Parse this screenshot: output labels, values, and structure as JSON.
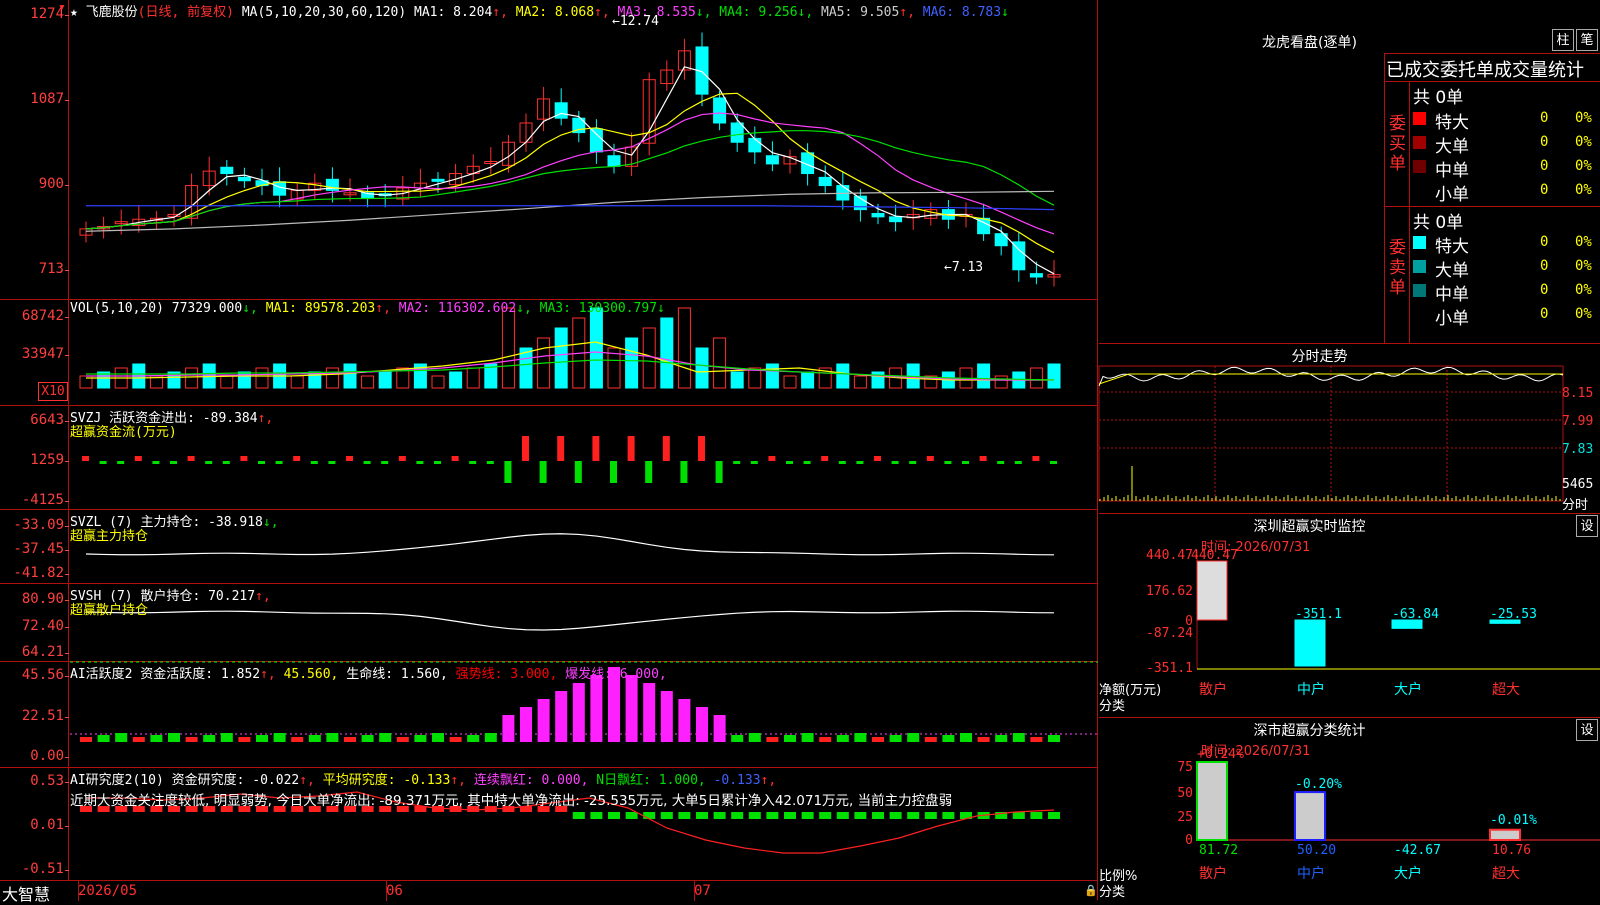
{
  "stock": {
    "star": "★",
    "name": "飞鹿股份",
    "mode": "(日线, 前复权)",
    "ma_label": "MA(5,10,20,30,60,120)",
    "ma": [
      {
        "name": "MA1",
        "value": "8.204",
        "arrow": "↑",
        "color": "#ffffff"
      },
      {
        "name": "MA2",
        "value": "8.068",
        "arrow": "↑",
        "color": "#ffff00"
      },
      {
        "name": "MA3",
        "value": "8.535",
        "arrow": "↓",
        "color": "#ff40ff"
      },
      {
        "name": "MA4",
        "value": "9.256",
        "arrow": "↓",
        "color": "#00e000"
      },
      {
        "name": "MA5",
        "value": "9.505",
        "arrow": "↑",
        "color": "#cccccc"
      },
      {
        "name": "MA6",
        "value": "8.783",
        "arrow": "↓",
        "color": "#4060ff"
      }
    ],
    "high_marker": "12.74",
    "low_marker": "7.13"
  },
  "price_axis": [
    "1274",
    "1087",
    "900",
    "713"
  ],
  "vol": {
    "label": "VOL(5,10,20)",
    "value": "77329.000",
    "value_arrow": "↓,",
    "ma1": "MA1: 89578.203",
    "ma1_arrow": "↑,",
    "ma2": "MA2: 116302.602",
    "ma2_arrow": "↓,",
    "ma3": "MA3: 130300.797",
    "ma3_arrow": "↓",
    "axis": [
      "68742",
      "33947",
      "X10"
    ]
  },
  "svzj": {
    "l1": "SVZJ  活跃资金进出: -89.384",
    "l1_arrow": "↑,",
    "l2": "超赢资金流(万元)",
    "axis": [
      "6643",
      "1259",
      "-4125"
    ]
  },
  "svzl": {
    "l1": "SVZL (7) 主力持仓: -38.918",
    "l1_arrow": "↓,",
    "l2": "超赢主力持仓",
    "axis": [
      "-33.09",
      "-37.45",
      "-41.82"
    ]
  },
  "svsh": {
    "l1": "SVSH (7) 散户持仓: 70.217",
    "l1_arrow": "↑,",
    "l2": "超赢散户持仓",
    "axis": [
      "80.90",
      "72.40",
      "64.21"
    ]
  },
  "ai1": {
    "l1": "AI活跃度2 资金活跃度: 1.852",
    "l1_arrow": "↑,",
    "a": "45.560,",
    "b": "生命线: 1.560,",
    "c": "强势线: 3.000,",
    "d": "爆发线: 6.000,",
    "axis": [
      "45.56",
      "22.51",
      "0.00"
    ]
  },
  "ai2": {
    "l1": "AI研究度2(10) 资金研究度: -0.022",
    "l1_arrow": "↑,",
    "a": "平均研究度: -0.133",
    "a_arrow": "↑,",
    "b": "连续飘红: 0.000,",
    "c": "N日飘红: 1.000,",
    "d": "-0.133",
    "d_arrow": "↑,",
    "note": "近期大资金关注度较低, 明显弱势, 今日大单净流出: -89.371万元, 其中特大单净流出: -25.535万元, 大单5日累计净入42.071万元, 当前主力控盘弱",
    "axis": [
      "0.53",
      "0.01",
      "-0.51"
    ]
  },
  "bottom": {
    "brand": "大智慧",
    "dates": [
      "2026/05",
      "06",
      "07"
    ]
  },
  "longhu": {
    "title": "龙虎看盘(逐单)",
    "btn1": "柱",
    "btn2": "笔",
    "header": "已成交委托单成交量统计",
    "buy_label": "委买单",
    "sell_label": "委卖单",
    "buy_total": "共 0单",
    "sell_total": "共 0单",
    "buy_rows": [
      {
        "name": "特大",
        "count": "0",
        "pct": "0%",
        "color": "#ff0000"
      },
      {
        "name": "大单",
        "count": "0",
        "pct": "0%",
        "color": "#a00000"
      },
      {
        "name": "中单",
        "count": "0",
        "pct": "0%",
        "color": "#700000"
      },
      {
        "name": "小单",
        "count": "0",
        "pct": "0%",
        "color": ""
      }
    ],
    "sell_rows": [
      {
        "name": "特大",
        "count": "0",
        "pct": "0%",
        "color": "#00ffff"
      },
      {
        "name": "大单",
        "count": "0",
        "pct": "0%",
        "color": "#00a0a0"
      },
      {
        "name": "中单",
        "count": "0",
        "pct": "0%",
        "color": "#007878"
      },
      {
        "name": "小单",
        "count": "0",
        "pct": "0%",
        "color": ""
      }
    ]
  },
  "intraday": {
    "title": "分时走势",
    "axis": [
      "8.15",
      "7.99",
      "7.83",
      "5465"
    ],
    "axis_foot": "分时"
  },
  "monitor": {
    "title": "深圳超赢实时监控",
    "btn": "设",
    "time": "时间: 2026/07/31",
    "axis": [
      "440.47",
      "176.62",
      "0",
      "-87.24",
      "-351.1"
    ],
    "ylabel": "净额(万元)",
    "xlabel": "分类",
    "cats": [
      "散户",
      "中户",
      "大户",
      "超大"
    ],
    "values": [
      "440.47",
      "-351.1",
      "-63.84",
      "-25.53"
    ]
  },
  "classify": {
    "title": "深市超赢分类统计",
    "btn": "设",
    "time": "时间: 2026/07/31",
    "axis": [
      "75",
      "50",
      "25",
      "0"
    ],
    "ylabel": "比例%",
    "xlabel": "分类",
    "cats": [
      "散户",
      "中户",
      "大户",
      "超大"
    ],
    "pct": [
      "+0.24%",
      "-0.20%",
      "",
      "-0.01%"
    ],
    "values": [
      "81.72",
      "50.20",
      "-42.67",
      "10.76"
    ]
  }
}
